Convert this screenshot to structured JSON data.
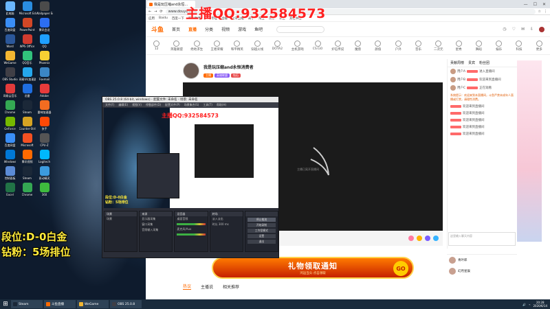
{
  "desktop": {
    "icons": [
      {
        "label": "此电脑",
        "color": "#6ab7ff"
      },
      {
        "label": "Microsoft Edge",
        "color": "#2a8de0"
      },
      {
        "label": "Wallpaper Engine",
        "color": "#4b4b4b"
      },
      {
        "label": "百度网盘",
        "color": "#3a8ef6"
      },
      {
        "label": "PowerPoint",
        "color": "#d24726"
      },
      {
        "label": "腾讯会议",
        "color": "#2c6ef2"
      },
      {
        "label": "Word",
        "color": "#2b579a"
      },
      {
        "label": "WPS Office",
        "color": "#d03b2f"
      },
      {
        "label": "QQ",
        "color": "#1e9fff"
      },
      {
        "label": "WeGame",
        "color": "#f2b632"
      },
      {
        "label": "QQ音乐",
        "color": "#31c27c"
      },
      {
        "label": "Phoenix",
        "color": "#f7d033"
      },
      {
        "label": "OBS Studio",
        "color": "#403f46"
      },
      {
        "label": "网易UU加速器",
        "color": "#25a7ec"
      },
      {
        "label": "Foxmail",
        "color": "#3b86c5"
      },
      {
        "label": "网易云音乐",
        "color": "#e23b3b"
      },
      {
        "label": "迅雷",
        "color": "#1f6ee0"
      },
      {
        "label": "Adobe",
        "color": "#e83b3b"
      },
      {
        "label": "Chrome",
        "color": "#34a853"
      },
      {
        "label": "Steam",
        "color": "#1b2838"
      },
      {
        "label": "雷神加速器",
        "color": "#f36c21"
      },
      {
        "label": "GeForce",
        "color": "#76b900"
      },
      {
        "label": "Counter-Strike",
        "color": "#d6a323"
      },
      {
        "label": "快手",
        "color": "#ff4906"
      },
      {
        "label": "百度网盘",
        "color": "#3a8ef6"
      },
      {
        "label": "Microsoft",
        "color": "#f25022"
      },
      {
        "label": "CPU-Z",
        "color": "#555555"
      },
      {
        "label": "Windows",
        "color": "#0078d7"
      },
      {
        "label": "腾讯视频",
        "color": "#ff6a00"
      },
      {
        "label": "Logitech",
        "color": "#00b8fc"
      },
      {
        "label": "控制面板",
        "color": "#5b8bd6"
      },
      {
        "label": "Steam",
        "color": "#1b2838"
      },
      {
        "label": "驱动精灵",
        "color": "#3c9bde"
      },
      {
        "label": "Excel",
        "color": "#217346"
      },
      {
        "label": "Chrome",
        "color": "#34a853"
      },
      {
        "label": "360",
        "color": "#3ebb3e"
      }
    ],
    "rank_overlay": [
      "段位:D-0白金",
      "钻粉：5场排位"
    ]
  },
  "browser": {
    "tab_title": "我是玩压缩and永恒...",
    "address": "www.douyu.com",
    "bookmarks": [
      "应用",
      "Baidu",
      "百度一下",
      "新浪微博",
      "哔哩哔哩",
      "直播",
      "虎牙直播",
      "知乎",
      "淘宝",
      "京东",
      "斗鱼",
      "其他书签"
    ],
    "watermark": "主播QQ:932584573"
  },
  "site": {
    "logo": "斗鱼",
    "nav": [
      {
        "label": "首页",
        "active": false
      },
      {
        "label": "直播",
        "active": true
      },
      {
        "label": "分类",
        "active": false
      },
      {
        "label": "视频",
        "active": false
      },
      {
        "label": "游戏",
        "active": false
      },
      {
        "label": "鱼吧",
        "active": false
      }
    ],
    "categories": [
      "12",
      "英雄联盟",
      "绝地求生",
      "王者荣耀",
      "和平精英",
      "穿越火线",
      "DOTA2",
      "主机游戏",
      "CS:GO",
      "炉石传说",
      "魔兽",
      "颜值",
      "户外",
      "音乐",
      "二次元",
      "星秀",
      "舞蹈",
      "娱乐",
      "科技",
      "更多"
    ]
  },
  "stream": {
    "title": "我是玩压缩and永恒消费者",
    "chips": [
      {
        "label": "主播",
        "color": "#ff6a00"
      },
      {
        "label": "英雄联盟",
        "color": "#8a5cf6"
      },
      {
        "label": "钻石",
        "color": "#e84d4d"
      }
    ],
    "player_hint": "主播已离开直播间",
    "banner_title": "礼物领取通知",
    "banner_sub": "鸿运当头·点击领取",
    "banner_go": "GO",
    "subtabs": [
      {
        "label": "热议",
        "active": true
      },
      {
        "label": "主播说",
        "active": false
      },
      {
        "label": "相关推荐",
        "active": false
      }
    ]
  },
  "chat": {
    "header": [
      "贡献周榜",
      "贵宾",
      "粉丝团"
    ],
    "rows": [
      {
        "name": "用户A",
        "text": "进入直播间"
      },
      {
        "name": "用户B",
        "text": "欢迎来到直播间"
      },
      {
        "name": "用户C",
        "text": "正在观看"
      }
    ],
    "notice": "系统提示：欢迎来到本直播间，斗鱼严禁未成年人直播或打赏，请理性消费。",
    "messages": [
      "欢迎来到直播间",
      "欢迎来到直播间",
      "欢迎来到直播间",
      "欢迎来到直播间",
      "欢迎来到直播间"
    ],
    "input_placeholder": "这里输入聊天内容",
    "rank": [
      {
        "name": "青叶郎"
      },
      {
        "name": "幻月星辰"
      }
    ]
  },
  "obs": {
    "title": "OBS 25.0.8 (64-bit, windows) - 配置文件: 未命名 - 场景: 未命名",
    "menu": [
      "文件(F)",
      "编辑(E)",
      "视图(V)",
      "停靠部件(D)",
      "配置文件(P)",
      "场景集合(S)",
      "工具(T)",
      "帮助(H)"
    ],
    "prev_qq": "主播QQ:932584573",
    "prev_rank": [
      "段位:D-0白金",
      "钻粉：5场排位"
    ],
    "docks": [
      {
        "title": "场景",
        "items": [
          "场景"
        ]
      },
      {
        "title": "来源",
        "items": [
          "显示器采集",
          "窗口采集",
          "音频输入采集"
        ]
      },
      {
        "title": "混音器",
        "items": [
          "桌面音频",
          "麦克风/Aux"
        ]
      },
      {
        "title": "转场",
        "items": [
          "淡入淡出",
          "时长 300 ms"
        ]
      }
    ],
    "controls": [
      "停止推流",
      "开始录制",
      "工作室模式",
      "设置",
      "退出"
    ]
  },
  "taskbar": {
    "items": [
      {
        "label": "Steam",
        "color": "#1b2838"
      },
      {
        "label": "斗鱼直播",
        "color": "#ff6a00"
      },
      {
        "label": "WeGame",
        "color": "#f2b632"
      },
      {
        "label": "OBS 25.0.8",
        "color": "#403f46"
      }
    ],
    "clock": "20:28",
    "date": "2020/6/14"
  }
}
